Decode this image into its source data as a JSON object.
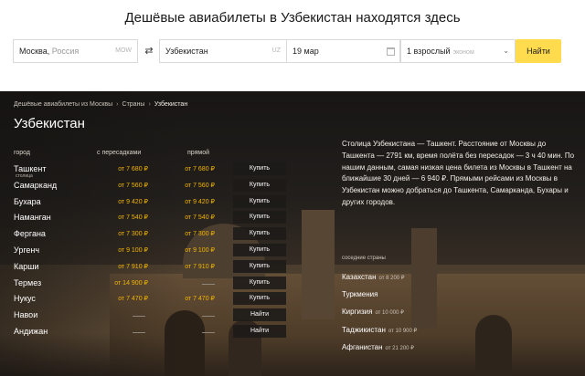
{
  "headline": "Дешёвые авиабилеты в Узбекистан находятся здесь",
  "search": {
    "from_city": "Москва,",
    "from_country": " Россия",
    "from_code": "MOW",
    "to_city": "Узбекистан",
    "to_code": "UZ",
    "date": "19 мар",
    "passengers": "1 взрослый",
    "class": "эконом",
    "find_label": "Найти"
  },
  "breadcrumbs": [
    "Дешёвые авиабилеты из Москвы",
    "Страны",
    "Узбекистан"
  ],
  "title": "Узбекистан",
  "columns": {
    "city": "город",
    "stops": "с пересадками",
    "direct": "прямой"
  },
  "cities": [
    {
      "name": "Ташкент",
      "sub": "столица",
      "stops": "от 7 680 ₽",
      "direct": "от 7 680 ₽",
      "action": "Купить"
    },
    {
      "name": "Самарканд",
      "stops": "от 7 560 ₽",
      "direct": "от 7 560 ₽",
      "action": "Купить"
    },
    {
      "name": "Бухара",
      "stops": "от 9 420 ₽",
      "direct": "от 9 420 ₽",
      "action": "Купить"
    },
    {
      "name": "Наманган",
      "stops": "от 7 540 ₽",
      "direct": "от 7 540 ₽",
      "action": "Купить"
    },
    {
      "name": "Фергана",
      "stops": "от 7 300 ₽",
      "direct": "от 7 300 ₽",
      "action": "Купить"
    },
    {
      "name": "Ургенч",
      "stops": "от 9 100 ₽",
      "direct": "от 9 100 ₽",
      "action": "Купить"
    },
    {
      "name": "Карши",
      "stops": "от 7 910 ₽",
      "direct": "от 7 910 ₽",
      "action": "Купить"
    },
    {
      "name": "Термез",
      "stops": "от 14 900 ₽",
      "direct": null,
      "action": "Купить"
    },
    {
      "name": "Нукус",
      "stops": "от 7 470 ₽",
      "direct": "от 7 470 ₽",
      "action": "Купить"
    },
    {
      "name": "Навои",
      "stops": null,
      "direct": null,
      "action": "Найти"
    },
    {
      "name": "Андижан",
      "stops": null,
      "direct": null,
      "action": "Найти"
    }
  ],
  "description": "Столица Узбекистана — Ташкент. Расстояние от Москвы до Ташкента — 2791 км, время полёта без пересадок — 3 ч 40 мин. По нашим данным, самая низкая цена билета из Москвы в Ташкент на ближайшие 30 дней — 6 940 ₽. Прямыми рейсами из Москвы в Узбекистан можно добраться до Ташкента, Самарканда, Бухары и других городов.",
  "neighbors_heading": "соседние страны",
  "neighbors": [
    {
      "name": "Казахстан",
      "price": "от 8 200 ₽"
    },
    {
      "name": "Туркмения",
      "price": ""
    },
    {
      "name": "Киргизия",
      "price": "от 10 000 ₽"
    },
    {
      "name": "Таджикистан",
      "price": "от 10 900 ₽"
    },
    {
      "name": "Афганистан",
      "price": "от 21 200 ₽"
    }
  ],
  "colors": {
    "accent": "#ffdb4d",
    "price": "#f2b400"
  }
}
